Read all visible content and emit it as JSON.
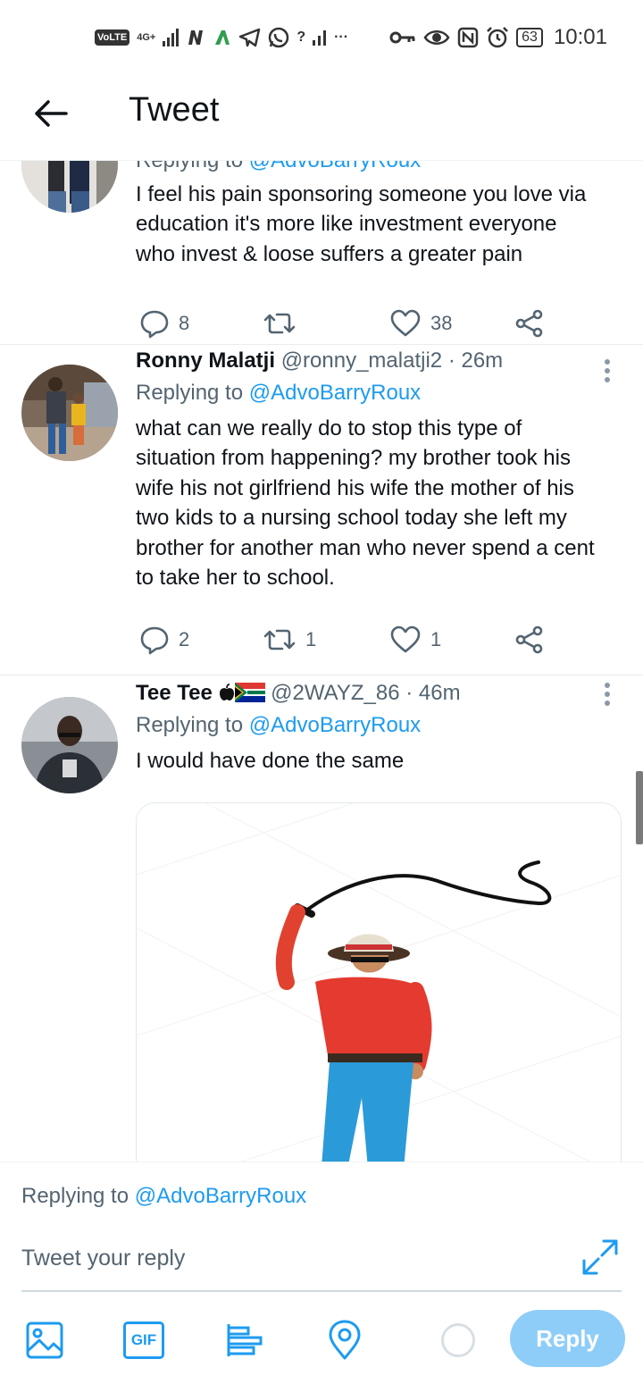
{
  "status_bar": {
    "volte": "VoLTE",
    "network": "4G+",
    "extra": "?",
    "dots": "···",
    "battery": "63",
    "time": "10:01"
  },
  "header": {
    "title": "Tweet"
  },
  "tweets": [
    {
      "replying_prefix": "Replying to ",
      "replying_handle": "@AdvoBarryRoux",
      "lines": [
        "I feel his pain sponsoring someone you love via",
        "education it's more like investment everyone",
        "who invest & loose suffers a greater pain"
      ],
      "replies": "8",
      "retweets": "",
      "likes": "38"
    },
    {
      "name": "Ronny Malatji",
      "handle": "@ronny_malatji2",
      "time": "· 26m",
      "replying_prefix": "Replying to ",
      "replying_handle": "@AdvoBarryRoux",
      "lines": [
        "what can we really do to stop this type of",
        "situation from happening? my brother took his",
        "wife his not girlfriend his wife the mother of his",
        "two kids to a nursing school today she left my",
        "brother for another man who never spend a cent",
        "to take her to school."
      ],
      "replies": "2",
      "retweets": "1",
      "likes": "1"
    },
    {
      "name": "Tee Tee",
      "name_emoji": "",
      "handle": "@2WAYZ_86",
      "time": "· 46m",
      "replying_prefix": "Replying to ",
      "replying_handle": "@AdvoBarryRoux",
      "lines": [
        "I would have done the same"
      ]
    }
  ],
  "composer": {
    "replying_prefix": "Replying to ",
    "replying_handle": "@AdvoBarryRoux",
    "placeholder": "Tweet your reply",
    "gif_label": "GIF",
    "reply_button": "Reply"
  },
  "colors": {
    "accent": "#1d9bf0",
    "reply_button_disabled": "#8ecdf8",
    "muted_text": "#536471"
  }
}
